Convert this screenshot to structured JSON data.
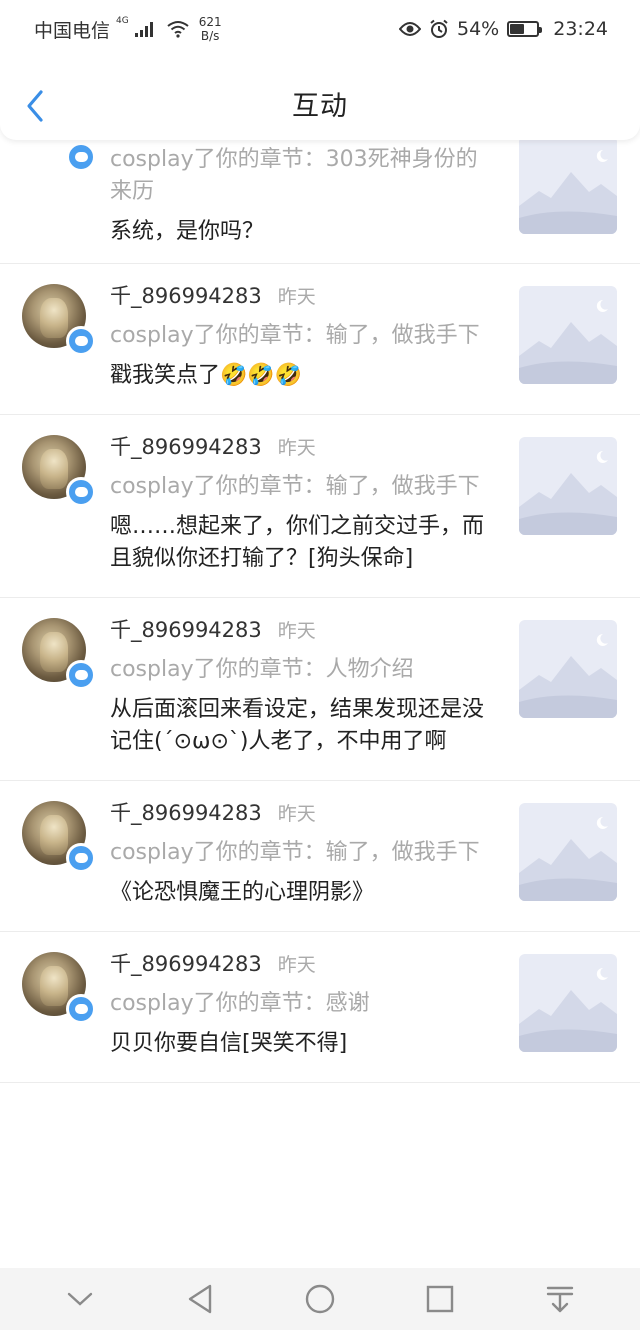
{
  "status_bar": {
    "carrier": "中国电信",
    "network": "4G",
    "speed_value": "621",
    "speed_unit": "B/s",
    "battery": "54%",
    "battery_level": 0.54,
    "time": "23:24",
    "icons": [
      "signal-icon",
      "wifi-icon",
      "eye-icon",
      "alarm-icon",
      "battery-icon"
    ]
  },
  "header": {
    "title": "互动",
    "back_icon": "chevron-left-icon",
    "accent": "#3a8ee6"
  },
  "feed": {
    "first_partial": {
      "ref": "cosplay了你的章节：303死神身份的来历",
      "comment": "系统，是你吗？"
    },
    "items": [
      {
        "username": "千_896994283",
        "time": "昨天",
        "ref": "cosplay了你的章节：输了，做我手下",
        "comment": "戳我笑点了🤣🤣🤣"
      },
      {
        "username": "千_896994283",
        "time": "昨天",
        "ref": "cosplay了你的章节：输了，做我手下",
        "comment": "嗯……想起来了，你们之前交过手，而且貌似你还打输了？[狗头保命]"
      },
      {
        "username": "千_896994283",
        "time": "昨天",
        "ref": "cosplay了你的章节：人物介绍",
        "comment": "从后面滚回来看设定，结果发现还是没记住(´⊙ω⊙`)人老了，不中用了啊"
      },
      {
        "username": "千_896994283",
        "time": "昨天",
        "ref": "cosplay了你的章节：输了，做我手下",
        "comment": "《论恐惧魔王的心理阴影》"
      },
      {
        "username": "千_896994283",
        "time": "昨天",
        "ref": "cosplay了你的章节：感谢",
        "comment": "贝贝你要自信[哭笑不得]"
      }
    ]
  },
  "navbar": {
    "icons": [
      "collapse-down-icon",
      "back-triangle-icon",
      "home-circle-icon",
      "recents-square-icon",
      "notification-pulldown-icon"
    ]
  }
}
